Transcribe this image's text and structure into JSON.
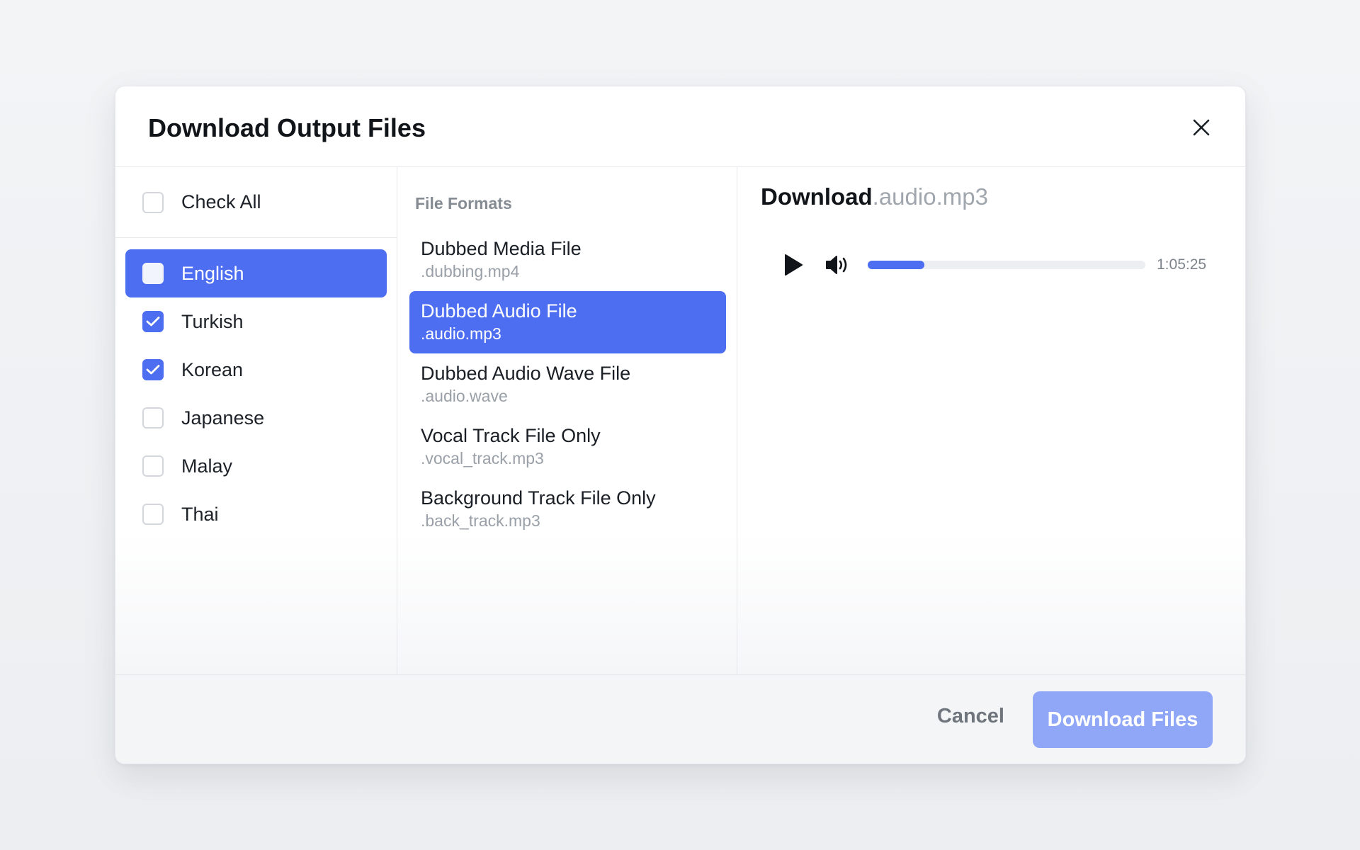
{
  "modal": {
    "title": "Download Output Files",
    "close_icon": "close-icon"
  },
  "languages": {
    "check_all_label": "Check All",
    "check_all_checked": false,
    "items": [
      {
        "label": "English",
        "checked": false,
        "selected": true
      },
      {
        "label": "Turkish",
        "checked": true,
        "selected": false
      },
      {
        "label": "Korean",
        "checked": true,
        "selected": false
      },
      {
        "label": "Japanese",
        "checked": false,
        "selected": false
      },
      {
        "label": "Malay",
        "checked": false,
        "selected": false
      },
      {
        "label": "Thai",
        "checked": false,
        "selected": false
      }
    ]
  },
  "formats": {
    "section_label": "File Formats",
    "items": [
      {
        "name": "Dubbed Media File",
        "ext": ".dubbing.mp4",
        "selected": false
      },
      {
        "name": "Dubbed Audio File",
        "ext": ".audio.mp3",
        "selected": true
      },
      {
        "name": "Dubbed Audio Wave File",
        "ext": ".audio.wave",
        "selected": false
      },
      {
        "name": "Vocal Track File Only",
        "ext": ".vocal_track.mp3",
        "selected": false
      },
      {
        "name": "Background Track File Only",
        "ext": ".back_track.mp3",
        "selected": false
      }
    ]
  },
  "preview": {
    "title_prefix": "Download",
    "title_file": ".audio.mp3",
    "player": {
      "play_icon": "play-icon",
      "volume_icon": "volume-icon",
      "progress_fraction": 0.205,
      "time": "1:05:25"
    }
  },
  "footer": {
    "cancel_label": "Cancel",
    "download_label": "Download Files"
  },
  "colors": {
    "accent": "#4e6ef2",
    "accent_disabled": "#90a6f6"
  }
}
